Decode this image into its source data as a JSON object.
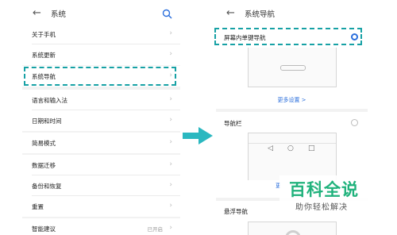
{
  "left": {
    "header": {
      "back": "←",
      "title": "系统"
    },
    "items": [
      {
        "label": "关于手机",
        "value": ""
      },
      {
        "label": "系统更新",
        "value": ""
      },
      {
        "label": "系统导航",
        "value": ""
      },
      {
        "label": "语言和输入法",
        "value": ""
      },
      {
        "label": "日期和时间",
        "value": ""
      },
      {
        "label": "简易模式",
        "value": ""
      },
      {
        "label": "数据迁移",
        "value": ""
      },
      {
        "label": "备份和恢复",
        "value": ""
      },
      {
        "label": "重置",
        "value": ""
      },
      {
        "label": "智能建议",
        "value": "已开启"
      }
    ]
  },
  "right": {
    "header": {
      "back": "←",
      "title": "系统导航"
    },
    "options": [
      {
        "label": "屏幕内单键导航",
        "selected": true,
        "link": "更多设置 >"
      },
      {
        "label": "导航栏",
        "selected": false,
        "nav_icons": [
          "◁",
          "○",
          "□"
        ]
      },
      {
        "label": "悬浮导航",
        "selected": false
      }
    ],
    "partial_link": "更"
  },
  "watermark": {
    "line1": "百科全说",
    "line2": "助你轻松解决"
  },
  "colors": {
    "highlight": "#17a1a5",
    "arrow": "#2bb8c0",
    "accent": "#2b6fdc",
    "watermark": "#20b27c"
  }
}
